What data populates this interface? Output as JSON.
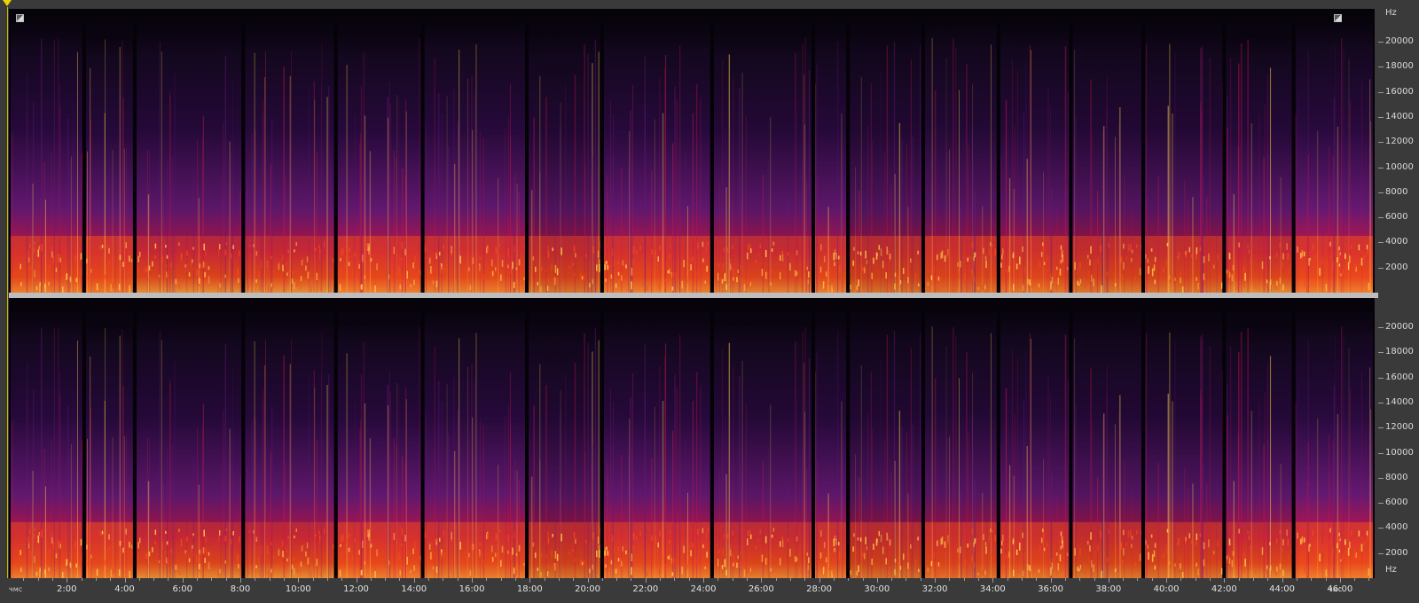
{
  "window": {
    "channel_count": 2
  },
  "freq_axis": {
    "unit_top": "Hz",
    "unit_bottom": "Hz",
    "labels": [
      "20000",
      "18000",
      "16000",
      "14000",
      "12000",
      "10000",
      "8000",
      "6000",
      "4000",
      "2000"
    ],
    "values": [
      20000,
      18000,
      16000,
      14000,
      12000,
      10000,
      8000,
      6000,
      4000,
      2000
    ],
    "max_hz": 22050
  },
  "time_axis": {
    "left_label": "чмс",
    "right_label": "чмс",
    "labels": [
      "2:00",
      "4:00",
      "6:00",
      "8:00",
      "10:00",
      "12:00",
      "14:00",
      "16:00",
      "18:00",
      "20:00",
      "22:00",
      "24:00",
      "26:00",
      "28:00",
      "30:00",
      "32:00",
      "34:00",
      "36:00",
      "38:00",
      "40:00",
      "42:00",
      "44:00",
      "46:00"
    ],
    "minutes": [
      2,
      4,
      6,
      8,
      10,
      12,
      14,
      16,
      18,
      20,
      22,
      24,
      26,
      28,
      30,
      32,
      34,
      36,
      38,
      40,
      42,
      44,
      46
    ],
    "total_minutes": 47.2
  },
  "spectrogram": {
    "track_boundaries_min": [
      0,
      2.6,
      4.35,
      8.1,
      11.3,
      14.3,
      17.9,
      20.5,
      24.3,
      27.8,
      29.0,
      31.6,
      34.2,
      36.7,
      39.2,
      42.0,
      44.4,
      47.2
    ],
    "colors": {
      "bg": "#0a0410",
      "low": "#2a0a40",
      "mid": "#6a1a78",
      "hot": "#c8164a",
      "hotter": "#f04a1c",
      "peak": "#ffd24a"
    }
  }
}
